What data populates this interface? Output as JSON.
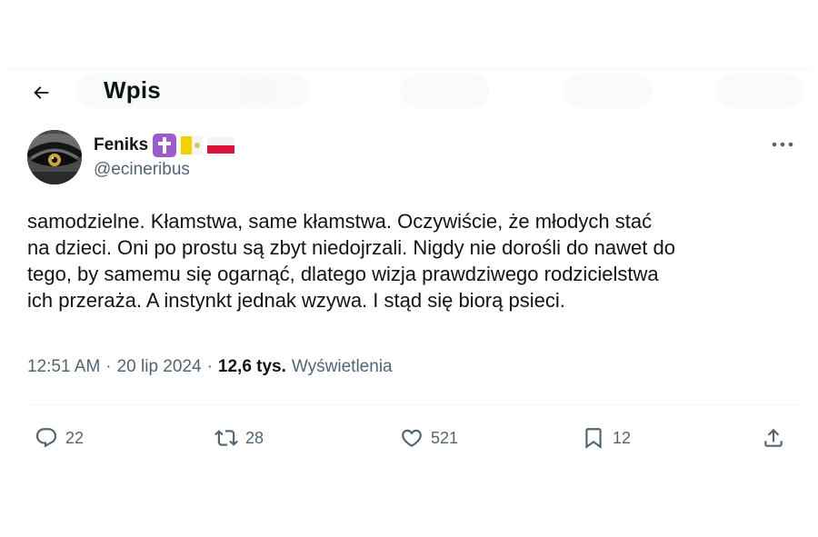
{
  "header": {
    "title": "Wpis"
  },
  "author": {
    "display_name": "Feniks",
    "handle": "@ecineribus",
    "badges": [
      "latin-cross-icon",
      "vatican-flag-icon",
      "poland-flag-icon"
    ]
  },
  "tweet": {
    "text": "samodzielne. Kłamstwa, same kłamstwa. Oczywiście, że młodych stać\nna dzieci. Oni po prostu są zbyt niedojrzali. Nigdy nie dorośli do nawet do\ntego, by samemu się ogarnąć, dlatego wizja prawdziwego rodzicielstwa\nich przeraża. A instynkt jednak wzywa. I stąd się biorą psieci."
  },
  "meta": {
    "time": "12:51 AM",
    "date": "20 lip 2024",
    "views_count": "12,6 tys.",
    "views_label": "Wyświetlenia",
    "separator": "·"
  },
  "actions": {
    "replies": "22",
    "reposts": "28",
    "likes": "521",
    "bookmarks": "12"
  },
  "colors": {
    "text_primary": "#0f1419",
    "text_secondary": "#536471",
    "divider": "#eff3f4"
  }
}
